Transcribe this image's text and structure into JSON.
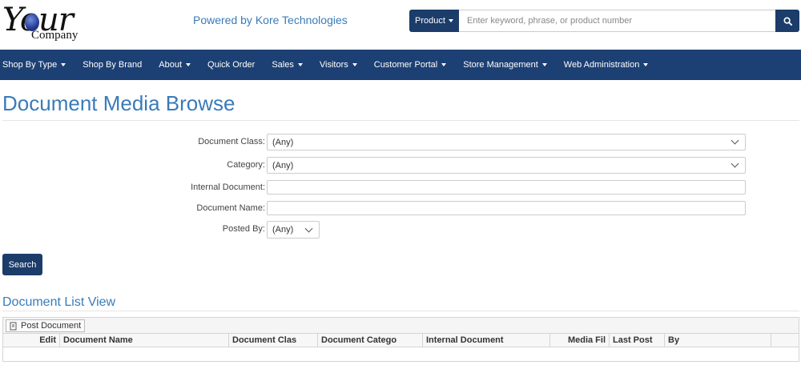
{
  "header": {
    "logo_your": "Your",
    "logo_company": "Company",
    "powered_by": "Powered by Kore Technologies",
    "search": {
      "category_label": "Product",
      "placeholder": "Enter keyword, phrase, or product number"
    }
  },
  "nav": {
    "items": [
      {
        "label": "Shop By Type"
      },
      {
        "label": "Shop By Brand"
      },
      {
        "label": "About"
      },
      {
        "label": "Quick Order"
      },
      {
        "label": "Sales"
      },
      {
        "label": "Visitors"
      },
      {
        "label": "Customer Portal"
      },
      {
        "label": "Store Management"
      },
      {
        "label": "Web Administration"
      }
    ]
  },
  "page": {
    "title": "Document Media Browse",
    "form": {
      "document_class_label": "Document Class:",
      "document_class_value": "(Any)",
      "category_label": "Category:",
      "category_value": "(Any)",
      "internal_document_label": "Internal Document:",
      "internal_document_value": "",
      "document_name_label": "Document Name:",
      "document_name_value": "",
      "posted_by_label": "Posted By:",
      "posted_by_value": "(Any)",
      "search_button": "Search"
    },
    "list": {
      "title": "Document List View",
      "post_button": "Post Document",
      "columns": [
        "Edit",
        "Document Name",
        "Document Clas",
        "Document Catego",
        "Internal Document",
        "Media Fil",
        "Last Post",
        "By",
        ""
      ]
    }
  },
  "colors": {
    "brand_navy": "#1c4073",
    "button_navy": "#1c3c6a",
    "title_blue": "#3a7bb8"
  }
}
